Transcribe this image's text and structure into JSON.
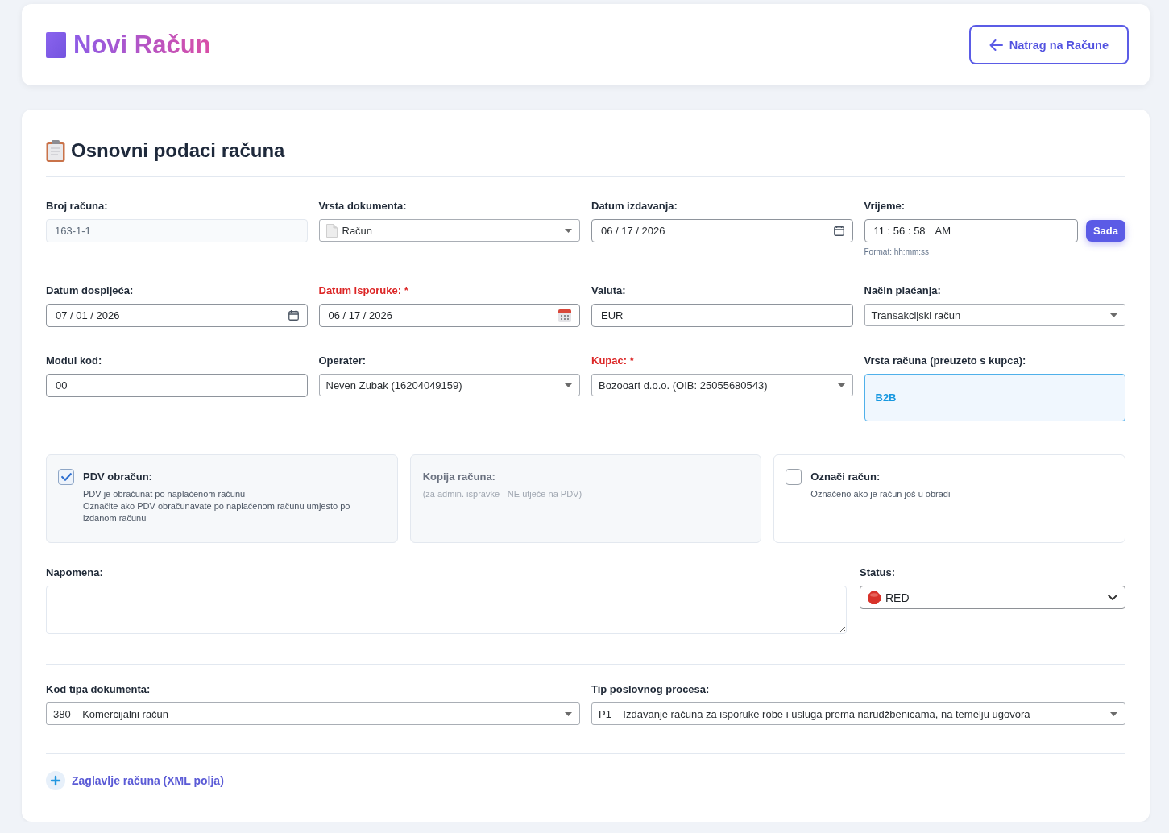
{
  "header": {
    "title": "Novi Račun",
    "back_button": "Natrag na Račune"
  },
  "section": {
    "title": "Osnovni podaci računa"
  },
  "fields": [
    {
      "kind": "readonly",
      "label": "Broj računa:",
      "required": false,
      "value": "163-1-1"
    },
    {
      "kind": "icon-select",
      "label": "Vrsta dokumenta:",
      "required": false,
      "value": "Račun"
    },
    {
      "kind": "date",
      "label": "Datum izdavanja:",
      "required": false,
      "value": "06 / 17 / 2026"
    },
    {
      "kind": "time",
      "label": "Vrijeme:",
      "required": false,
      "value": "11 : 56 : 58",
      "period": "AM",
      "button": "Sada",
      "hint": "Format: hh:mm:ss"
    },
    {
      "kind": "date",
      "label": "Datum dospijeća:",
      "required": false,
      "value": "07 / 01 / 2026"
    },
    {
      "kind": "date",
      "label": "Datum isporuke:",
      "required": true,
      "required_mark": "*",
      "value": "06 / 17 / 2026"
    },
    {
      "kind": "text",
      "label": "Valuta:",
      "required": false,
      "value": "EUR"
    },
    {
      "kind": "select",
      "label": "Način plaćanja:",
      "required": false,
      "value": "Transakcijski račun"
    },
    {
      "kind": "text",
      "label": "Modul kod:",
      "required": false,
      "value": "00"
    },
    {
      "kind": "select",
      "label": "Operater:",
      "required": false,
      "value": "Neven Zubak (16204049159)"
    },
    {
      "kind": "select",
      "label": "Kupac:",
      "required": true,
      "required_mark": "*",
      "value": "Bozooart d.o.o. (OIB: 25055680543)"
    },
    {
      "kind": "display",
      "label": "Vrsta računa (preuzeto s kupca):",
      "required": false,
      "value": "B2B"
    }
  ],
  "options": [
    {
      "kind": "checkbox",
      "title": "PDV obračun:",
      "description": [
        "PDV je obračunat po naplaćenom računu",
        "Označite ako PDV obračunavate po naplaćenom računu umjesto po izdanom računu"
      ],
      "checked": true,
      "disabled": false
    },
    {
      "kind": "note",
      "title": "Kopija računa:",
      "description": [
        "(za admin. ispravke - NE utječe na PDV)"
      ],
      "disabled": true
    },
    {
      "kind": "checkbox",
      "title": "Označi račun:",
      "description": [
        "Označeno ako je račun još u obradi"
      ],
      "checked": false,
      "disabled": false
    }
  ],
  "note": {
    "label": "Napomena:"
  },
  "status": {
    "label": "Status:",
    "value": "RED"
  },
  "codes": [
    {
      "kind": "select",
      "label": "Kod tipa dokumenta:",
      "required": false,
      "value": "380 – Komercijalni račun"
    },
    {
      "kind": "select",
      "label": "Tip poslovnog procesa:",
      "required": false,
      "value": "P1 – Izdavanje računa za isporuke robe i usluga prema narudžbenicama, na temelju ugovora"
    }
  ],
  "expander": {
    "label": "Zaglavlje računa (XML polja)",
    "expanded": false
  }
}
